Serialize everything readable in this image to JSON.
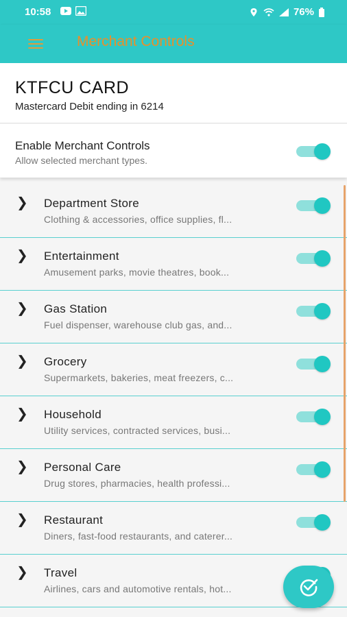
{
  "status_bar": {
    "time": "10:58",
    "battery": "76%"
  },
  "app_bar": {
    "title": "Merchant Controls"
  },
  "card": {
    "name": "KTFCU CARD",
    "subtitle": "Mastercard Debit ending in 6214"
  },
  "enable": {
    "title": "Enable Merchant Controls",
    "subtitle": "Allow selected merchant types.",
    "enabled": true
  },
  "colors": {
    "accent": "#2ec8c6",
    "title_orange": "#e8902a",
    "toggle_thumb": "#20c7c2",
    "toggle_track": "#8fe0dc",
    "divider": "#58cfcf"
  },
  "merchants": [
    {
      "title": "Department Store",
      "desc": "Clothing & accessories, office supplies, fl...",
      "enabled": true
    },
    {
      "title": "Entertainment",
      "desc": "Amusement parks, movie theatres, book...",
      "enabled": true
    },
    {
      "title": "Gas Station",
      "desc": "Fuel dispenser, warehouse club gas, and...",
      "enabled": true
    },
    {
      "title": "Grocery",
      "desc": "Supermarkets, bakeries, meat freezers, c...",
      "enabled": true
    },
    {
      "title": "Household",
      "desc": "Utility services, contracted services, busi...",
      "enabled": true
    },
    {
      "title": "Personal Care",
      "desc": "Drug stores, pharmacies, health professi...",
      "enabled": true
    },
    {
      "title": "Restaurant",
      "desc": "Diners, fast-food restaurants, and caterer...",
      "enabled": true
    },
    {
      "title": "Travel",
      "desc": "Airlines, cars and automotive rentals, hot...",
      "enabled": true
    }
  ],
  "icons": {
    "menu": "hamburger-icon",
    "expand": "chevron-right-icon",
    "fab": "check-circle-icon"
  }
}
